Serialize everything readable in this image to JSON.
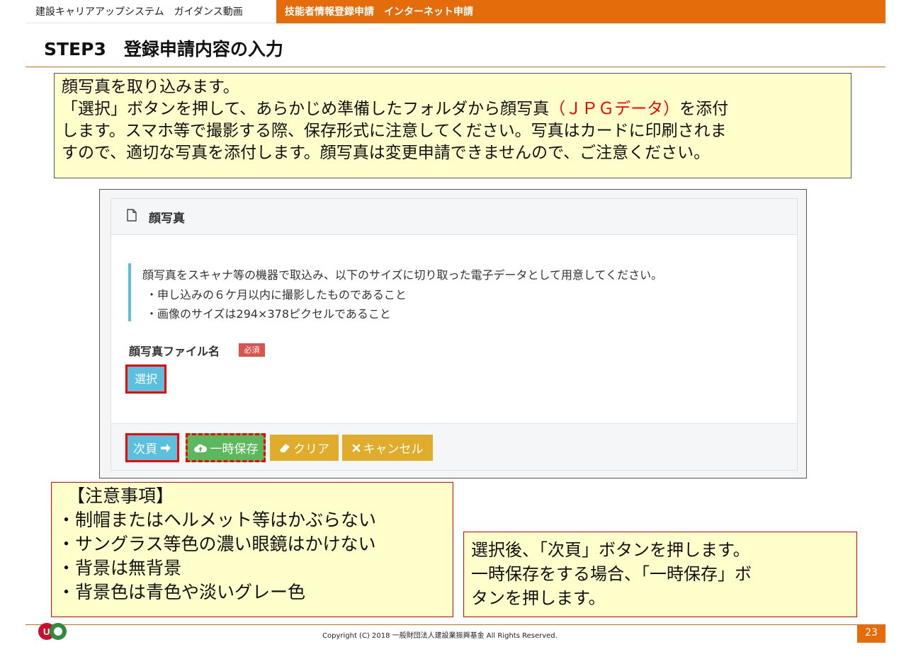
{
  "header": {
    "left_tab": "建設キャリアアップシステム　ガイダンス動画",
    "right_tab": "技能者情報登録申請　インターネット申請"
  },
  "step_title": "STEP3　登録申請内容の入力",
  "intro": {
    "line1": "顔写真を取り込みます。",
    "line2_a": "「選択」ボタンを押して、あらかじめ準備したフォルダから顔写真",
    "line2_red": "（ＪＰＧデータ）",
    "line2_b": "を添付",
    "line3": "します。スマホ等で撮影する際、保存形式に注意してください。写真はカードに印刷されま",
    "line4": "すので、適切な写真を添付します。顔写真は変更申請できませんので、ご注意ください。"
  },
  "panel": {
    "title": "顔写真",
    "info_main": "顔写真をスキャナ等の機器で取込み、以下のサイズに切り取った電子データとして用意してください。",
    "info_bullet1": "・申し込みの６ケ月以内に撮影したものであること",
    "info_bullet2": "・画像のサイズは294×378ピクセルであること",
    "field_label": "顔写真ファイル名",
    "required_badge": "必須",
    "select_button": "選択"
  },
  "buttons": {
    "next": "次頁",
    "save": "一時保存",
    "clear": "クリア",
    "cancel": "キャンセル"
  },
  "caution": {
    "heading": "【注意事項】",
    "items": [
      "・制帽またはヘルメット等はかぶらない",
      "・サングラス等色の濃い眼鏡はかけない",
      "・背景は無背景",
      "・背景色は青色や淡いグレー色"
    ]
  },
  "step_note": {
    "line1": "選択後、「次頁」ボタンを押します。",
    "line2": "一時保存をする場合、「一時保存」ボ",
    "line3": "タンを押します。"
  },
  "footer": {
    "copyright": "Copyright (C) 2018 一般財団法人建設業振興基金 All Rights Reserved.",
    "page_number": "23"
  },
  "icons": {
    "document": "document-icon",
    "arrow_right": "arrow-right-icon",
    "cloud_upload": "cloud-upload-icon",
    "eraser": "eraser-icon",
    "close": "close-icon"
  },
  "colors": {
    "brand_orange": "#e46c0a",
    "note_yellow": "#ffffcc",
    "highlight_red": "#ff0000",
    "info_blue": "#5bc0de",
    "save_green": "#5cb85c",
    "warning_yellow": "#e0ac2b",
    "danger_red": "#d9534f"
  }
}
